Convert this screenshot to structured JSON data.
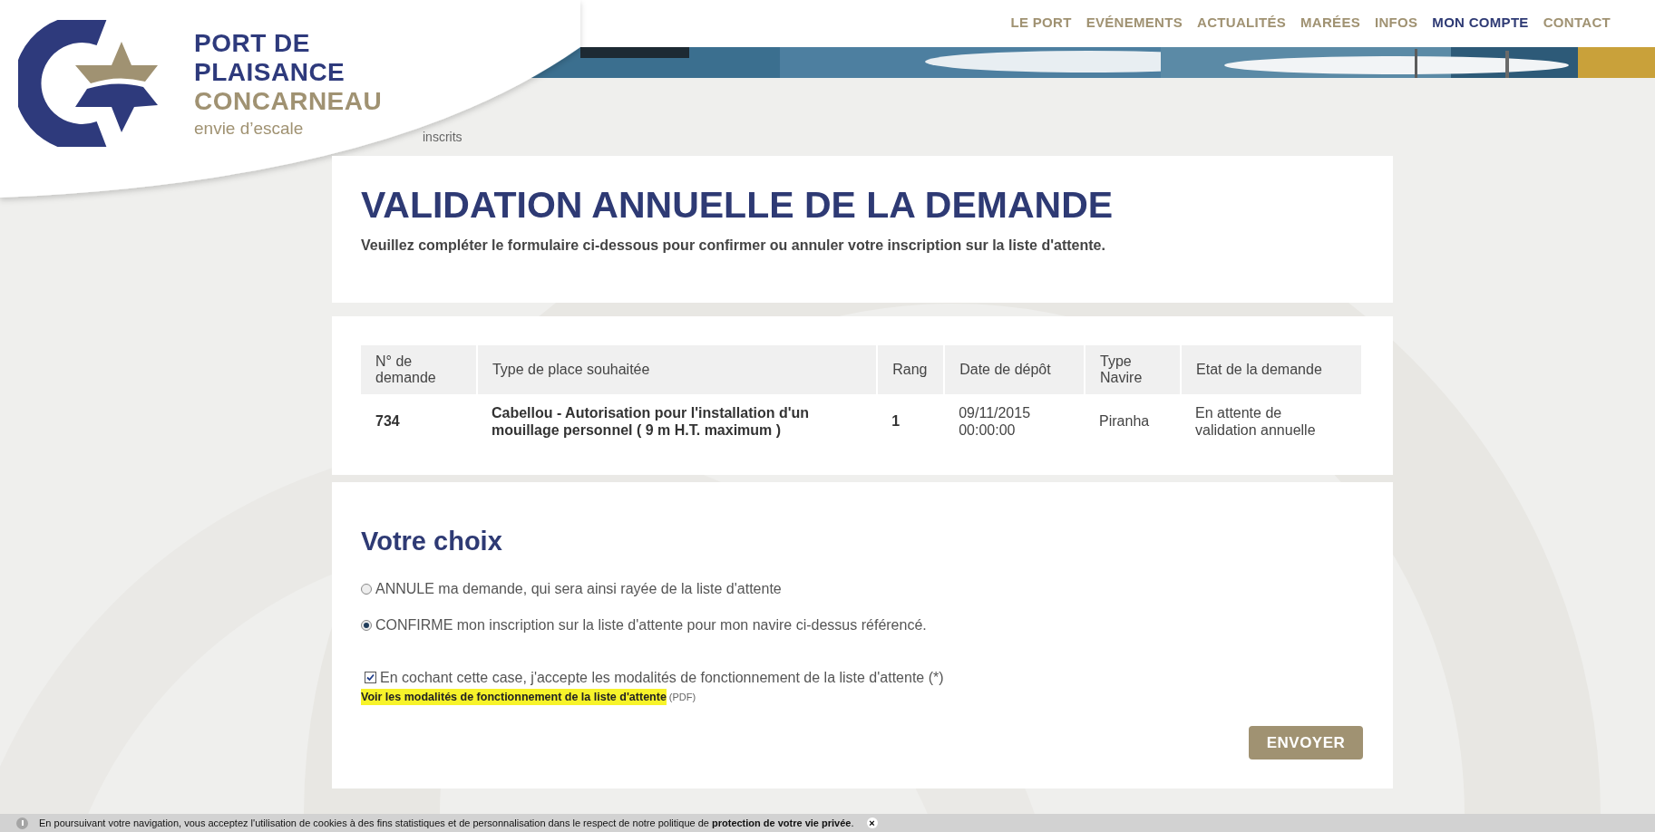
{
  "header": {
    "logo": {
      "line_1": "PORT DE",
      "line_2": "PLAISANCE",
      "line_3": "CONCARNEAU",
      "tagline": "envie d’escale"
    },
    "nav": [
      {
        "label": "LE PORT",
        "selected": false
      },
      {
        "label": "EVÉNEMENTS",
        "selected": false
      },
      {
        "label": "ACTUALITÉS",
        "selected": false
      },
      {
        "label": "MARÉES",
        "selected": false
      },
      {
        "label": "INFOS",
        "selected": false
      },
      {
        "label": "MON COMPTE",
        "selected": true
      },
      {
        "label": "CONTACT",
        "selected": false
      }
    ]
  },
  "breadcrumb": "inscrits",
  "page": {
    "title": "VALIDATION ANNUELLE DE LA DEMANDE",
    "intro": "Veuillez compléter le formulaire ci-dessous pour confirmer ou annuler votre inscription sur la liste d'attente."
  },
  "table": {
    "columns": [
      "N° de demande",
      "Type de place souhaitée",
      "Rang",
      "Date de dépôt",
      "Type Navire",
      "Etat de la demande"
    ],
    "rows": [
      {
        "cells": [
          {
            "text": "734",
            "bold": true
          },
          {
            "text": "Cabellou - Autorisation pour l'installation d'un mouillage personnel ( 9 m H.T. maximum )",
            "bold": true
          },
          {
            "text": "1",
            "bold": true
          },
          {
            "text": "09/11/2015 00:00:00",
            "bold": false
          },
          {
            "text": "Piranha",
            "bold": false
          },
          {
            "text": "En attente de validation annuelle",
            "bold": false
          }
        ]
      }
    ]
  },
  "choice": {
    "title": "Votre choix",
    "options": [
      {
        "label": "ANNULE ma demande, qui sera ainsi rayée de la liste d'attente",
        "selected": false
      },
      {
        "label": "CONFIRME mon inscription sur la liste d'attente pour mon navire ci-dessus référencé.",
        "selected": true
      }
    ],
    "agreement": {
      "label": "En cochant cette case, j'accepte les modalités de fonctionnement de la liste d'attente (*)",
      "checked": true
    },
    "link": {
      "label": "Voir les modalités de fonctionnement de la liste d'attente",
      "note": "(PDF)"
    },
    "submit": "ENVOYER"
  },
  "cookie_bar": {
    "text": "En poursuivant votre navigation, vous acceptez l'utilisation de cookies à des fins statistiques et de personnalisation dans le respect de notre politique de **protection de votre vie privée**.",
    "close": "×"
  }
}
